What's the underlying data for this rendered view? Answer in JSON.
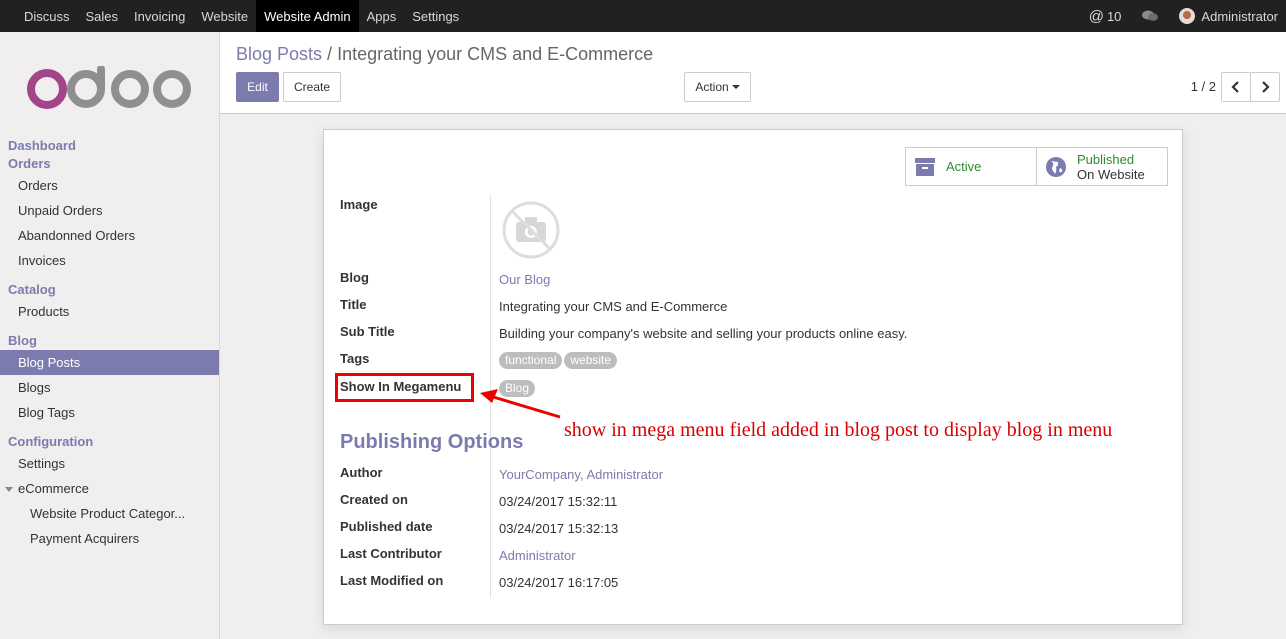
{
  "topbar": {
    "menu": [
      "Discuss",
      "Sales",
      "Invoicing",
      "Website",
      "Website Admin",
      "Apps",
      "Settings"
    ],
    "active_menu": "Website Admin",
    "messages_count": "10",
    "user_name": "Administrator"
  },
  "sidebar": {
    "logo_text": "odoo",
    "sections": [
      {
        "title": "Dashboard",
        "items": []
      },
      {
        "title": "Orders",
        "items": [
          "Orders",
          "Unpaid Orders",
          "Abandonned Orders",
          "Invoices"
        ]
      },
      {
        "title": "Catalog",
        "items": [
          "Products"
        ]
      },
      {
        "title": "Blog",
        "items": [
          "Blog Posts",
          "Blogs",
          "Blog Tags"
        ]
      },
      {
        "title": "Configuration",
        "items": [
          "Settings"
        ]
      }
    ],
    "ecommerce_group": "eCommerce",
    "ecommerce_items": [
      "Website Product Categor...",
      "Payment Acquirers"
    ],
    "active_item": "Blog Posts"
  },
  "control_panel": {
    "breadcrumb_parent": "Blog Posts",
    "breadcrumb_sep": " / ",
    "breadcrumb_current": "Integrating your CMS and E-Commerce",
    "edit_label": "Edit",
    "create_label": "Create",
    "action_label": "Action",
    "pager": "1 / 2"
  },
  "form": {
    "smart_buttons": {
      "active_label": "Active",
      "published_line1": "Published",
      "published_line2": "On Website"
    },
    "fields": {
      "image_label": "Image",
      "blog_label": "Blog",
      "blog_value": "Our Blog",
      "title_label": "Title",
      "title_value": "Integrating your CMS and E-Commerce",
      "subtitle_label": "Sub Title",
      "subtitle_value": "Building your company's website and selling your products online easy.",
      "tags_label": "Tags",
      "tags": [
        "functional",
        "website"
      ],
      "megamenu_label": "Show In Megamenu",
      "megamenu_value": "Blog"
    },
    "publishing_title": "Publishing Options",
    "publishing": {
      "author_label": "Author",
      "author_value": "YourCompany, Administrator",
      "created_label": "Created on",
      "created_value": "03/24/2017 15:32:11",
      "published_label": "Published date",
      "published_value": "03/24/2017 15:32:13",
      "contributor_label": "Last Contributor",
      "contributor_value": "Administrator",
      "modified_label": "Last Modified on",
      "modified_value": "03/24/2017 16:17:05"
    }
  },
  "annotation": {
    "text": "show in mega menu field added in blog post to display blog in menu",
    "color": "#d80000"
  },
  "colors": {
    "brand": "#7c7bad",
    "topbar": "#212121",
    "published_green": "#2f8a2f"
  }
}
